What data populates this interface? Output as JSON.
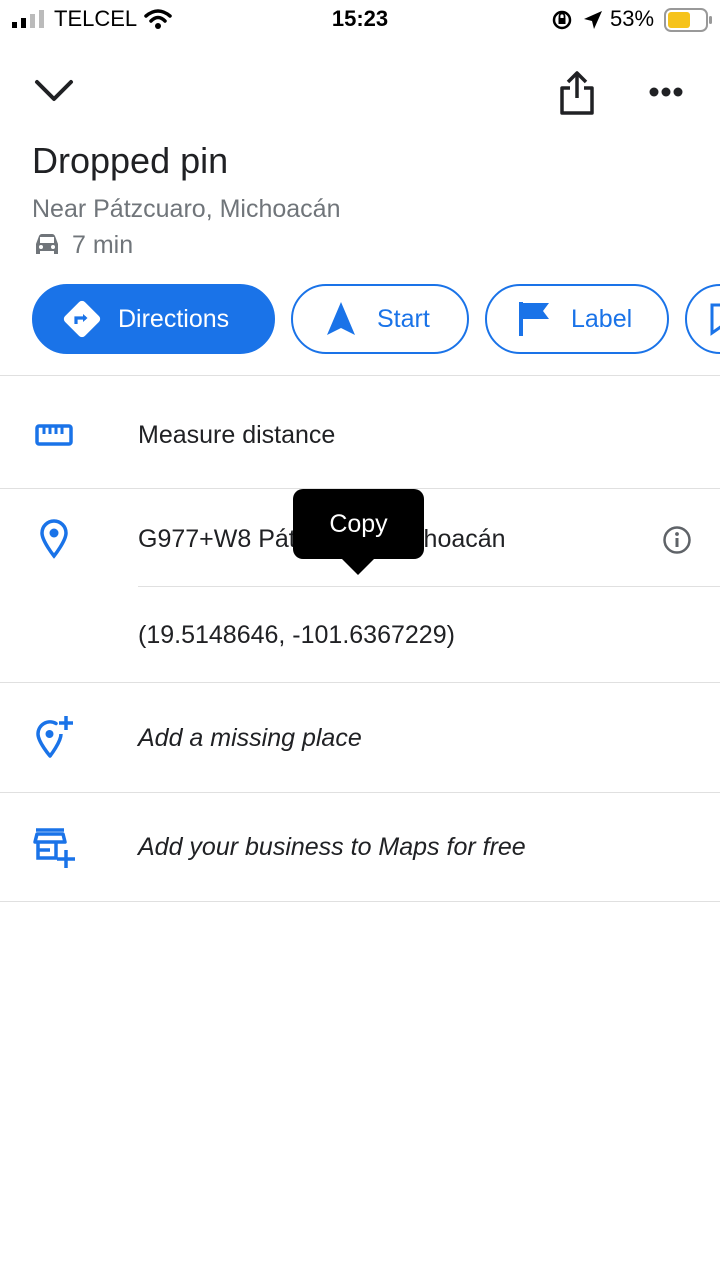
{
  "status_bar": {
    "carrier": "TELCEL",
    "time": "15:23",
    "battery_percent": "53%"
  },
  "header": {
    "collapse_icon": "chevron-down-icon",
    "share_icon": "share-icon",
    "more_icon": "more-horizontal-icon"
  },
  "place": {
    "title": "Dropped pin",
    "subtitle": "Near Pátzcuaro, Michoacán",
    "travel_time": "7 min"
  },
  "actions": [
    {
      "label": "Directions",
      "icon": "directions-icon"
    },
    {
      "label": "Start",
      "icon": "navigation-arrow-icon"
    },
    {
      "label": "Label",
      "icon": "flag-icon"
    }
  ],
  "rows": {
    "measure_distance": "Measure distance",
    "plus_code": "G977+W8 Pátzcuaro, Michoacán",
    "coordinates": "(19.5148646, -101.6367229)",
    "add_missing_place": "Add a missing place",
    "add_business": "Add your business to Maps for free"
  },
  "tooltip": {
    "label": "Copy"
  },
  "colors": {
    "accent": "#1a73e8",
    "text_primary": "#202124",
    "text_secondary": "#70757a",
    "battery": "#f6c31b"
  }
}
